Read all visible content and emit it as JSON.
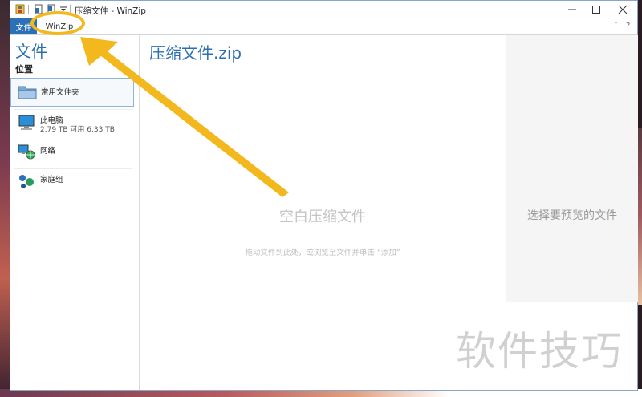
{
  "window": {
    "title": "压缩文件 - WinZip",
    "minimize_icon": "minimize-icon",
    "maximize_icon": "maximize-icon",
    "close_icon": "close-icon"
  },
  "ribbon": {
    "file_tab": "文件",
    "winzip_tab": "WinZip",
    "collapse_glyph": "˅",
    "help_glyph": "?"
  },
  "left_panel": {
    "title": "文件",
    "section": "位置",
    "items": [
      {
        "name": "常用文件夹",
        "detail": "",
        "icon": "folder-icon"
      },
      {
        "name": "此电脑",
        "detail": "2.79 TB 可用 6.33 TB",
        "icon": "computer-icon"
      },
      {
        "name": "网络",
        "detail": "",
        "icon": "network-icon"
      },
      {
        "name": "家庭组",
        "detail": "",
        "icon": "homegroup-icon"
      }
    ]
  },
  "center": {
    "zip_name": "压缩文件.zip",
    "empty_title": "空白压缩文件",
    "empty_hint": "拖动文件到此处，或浏览至文件并单击 “添加”"
  },
  "preview": {
    "placeholder": "选择要预览的文件"
  },
  "watermark": "软件技巧",
  "colors": {
    "accent": "#2b71b8",
    "title_blue": "#2b6fb0",
    "annotation": "#f4b81f"
  }
}
